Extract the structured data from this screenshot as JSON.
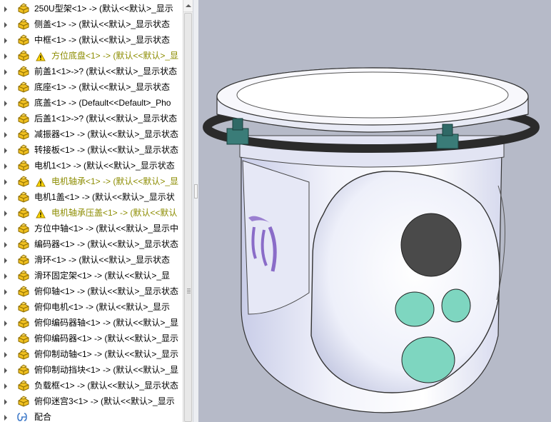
{
  "feature_tree": {
    "items": [
      {
        "label": "250U型架<1> -> (默认<<默认>_显示",
        "warning": false
      },
      {
        "label": "侧盖<1> -> (默认<<默认>_显示状态",
        "warning": false
      },
      {
        "label": "中框<1> -> (默认<<默认>_显示状态",
        "warning": false
      },
      {
        "label": "方位底盘<1> -> (默认<<默认>_显",
        "warning": true
      },
      {
        "label": "前盖1<1>->? (默认<<默认>_显示状态",
        "warning": false
      },
      {
        "label": "底座<1> -> (默认<<默认>_显示状态",
        "warning": false
      },
      {
        "label": "底盖<1> -> (Default<<Default>_Pho",
        "warning": false
      },
      {
        "label": "后盖1<1>->? (默认<<默认>_显示状态",
        "warning": false
      },
      {
        "label": "减振器<1> -> (默认<<默认>_显示状态",
        "warning": false
      },
      {
        "label": "转接板<1> -> (默认<<默认>_显示状态",
        "warning": false
      },
      {
        "label": "电机1<1> -> (默认<<默认>_显示状态",
        "warning": false
      },
      {
        "label": "电机轴承<1> -> (默认<<默认>_显",
        "warning": true
      },
      {
        "label": "电机1盖<1> -> (默认<<默认>_显示状",
        "warning": false
      },
      {
        "label": "电机轴承压盖<1> -> (默认<<默认",
        "warning": true
      },
      {
        "label": "方位中轴<1> -> (默认<<默认>_显示中",
        "warning": false
      },
      {
        "label": "编码器<1> -> (默认<<默认>_显示状态",
        "warning": false
      },
      {
        "label": "滑环<1> -> (默认<<默认>_显示状态",
        "warning": false
      },
      {
        "label": "滑环固定架<1> -> (默认<<默认>_显",
        "warning": false
      },
      {
        "label": "俯仰轴<1> -> (默认<<默认>_显示状态",
        "warning": false
      },
      {
        "label": "俯仰电机<1> -> (默认<<默认>_显示",
        "warning": false
      },
      {
        "label": "俯仰编码器轴<1> -> (默认<<默认>_显",
        "warning": false
      },
      {
        "label": "俯仰编码器<1> -> (默认<<默认>_显示",
        "warning": false
      },
      {
        "label": "俯仰制动轴<1> -> (默认<<默认>_显示",
        "warning": false
      },
      {
        "label": "俯仰制动挡块<1> -> (默认<<默认>_显",
        "warning": false
      },
      {
        "label": "负载框<1> -> (默认<<默认>_显示状态",
        "warning": false
      },
      {
        "label": "俯仰迷宫3<1> -> (默认<<默认>_显示",
        "warning": false
      }
    ],
    "mates_label": "配合"
  },
  "icons": {
    "part": "part-icon",
    "warning": "warning-icon",
    "mates": "mates-icon",
    "expander": "expander-arrow-icon"
  },
  "colors": {
    "viewport_bg": "#b6bac8",
    "part_icon": "#f0c020",
    "warning_text": "#8c8c00",
    "optic_window": "#7ed6c0",
    "dark_window": "#4a4a4a"
  },
  "model": {
    "name": "gimbal-assembly"
  }
}
